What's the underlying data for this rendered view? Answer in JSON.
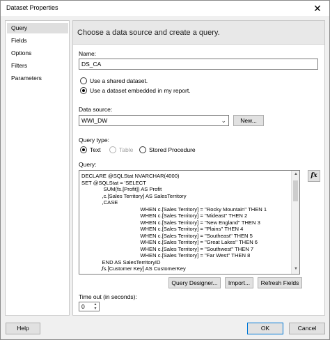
{
  "window": {
    "title": "Dataset Properties"
  },
  "nav": {
    "items": [
      "Query",
      "Fields",
      "Options",
      "Filters",
      "Parameters"
    ]
  },
  "header": {
    "text": "Choose a data source and create a query."
  },
  "name": {
    "label": "Name:",
    "value": "DS_CA"
  },
  "dataset_choice": {
    "shared_label": "Use a shared dataset.",
    "embedded_label": "Use a dataset embedded in my report.",
    "selected": "embedded"
  },
  "data_source": {
    "label": "Data source:",
    "value": "WWI_DW",
    "new_button": "New..."
  },
  "query_type": {
    "label": "Query type:",
    "options": [
      "Text",
      "Table",
      "Stored Procedure"
    ],
    "selected": "Text"
  },
  "query": {
    "label": "Query:",
    "lines": [
      "DECLARE @SQLStat NVARCHAR(4000)",
      "SET @SQLStat = 'SELECT",
      "               SUM(fs.[Profit]) AS Profit",
      "              ,c.[Sales Territory] AS SalesTerritory",
      "              ,CASE",
      "                                        WHEN c.[Sales Territory] = ''Rocky Mountain'' THEN 1",
      "                                        WHEN c.[Sales Territory] = ''Mideast'' THEN 2",
      "                                        WHEN c.[Sales Territory] = ''New England'' THEN 3",
      "                                        WHEN c.[Sales Territory] = ''Plains'' THEN 4",
      "                                        WHEN c.[Sales Territory] = ''Southeast'' THEN 5",
      "                                        WHEN c.[Sales Territory] = ''Great Lakes'' THEN 6",
      "                                        WHEN c.[Sales Territory] = ''Southwest'' THEN 7",
      "                                        WHEN c.[Sales Territory] = ''Far West'' THEN 8",
      "              END AS SalesTerritoryID",
      "             ,fs.[Customer Key] AS CustomerKey"
    ]
  },
  "query_buttons": {
    "designer": "Query Designer...",
    "import": "Import...",
    "refresh": "Refresh Fields"
  },
  "timeout": {
    "label": "Time out (in seconds):",
    "value": "0"
  },
  "footer": {
    "help": "Help",
    "ok": "OK",
    "cancel": "Cancel"
  }
}
